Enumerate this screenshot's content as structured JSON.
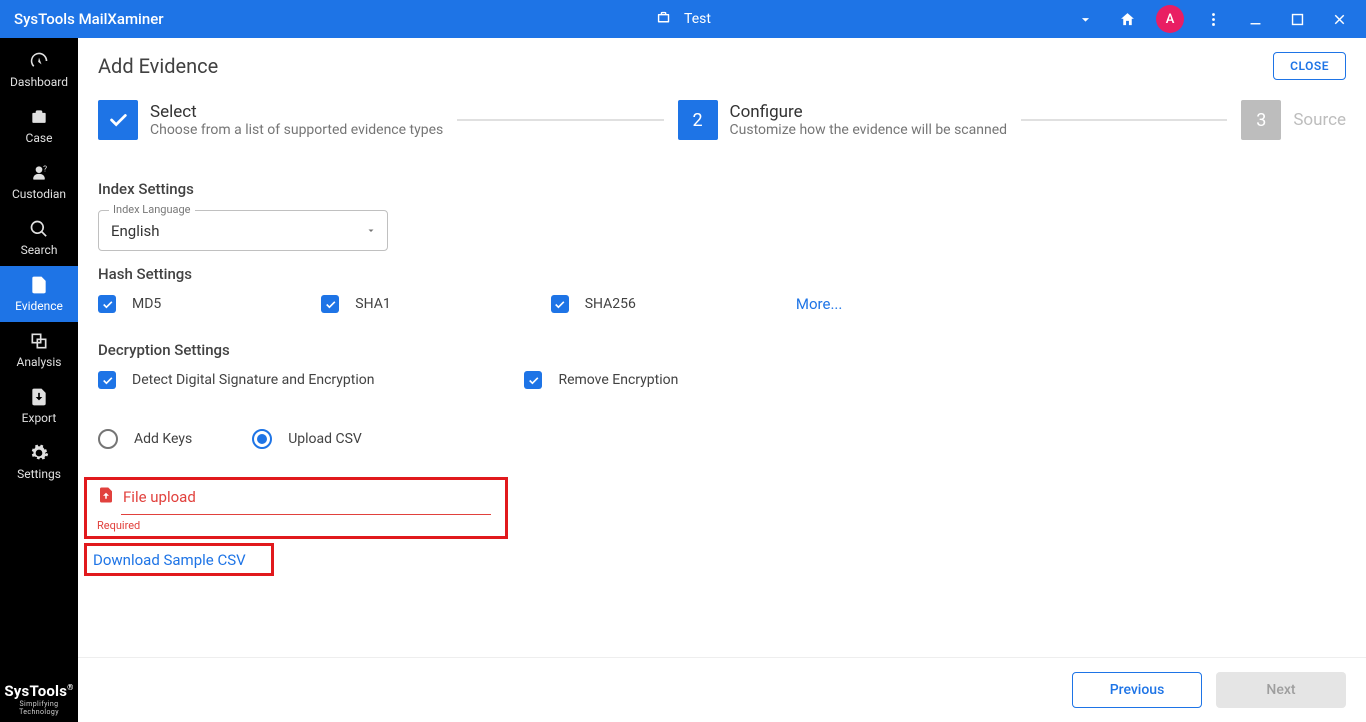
{
  "app_title": "SysTools MailXaminer",
  "case_label": "Test",
  "avatar_letter": "A",
  "sidebar": {
    "items": [
      {
        "label": "Dashboard"
      },
      {
        "label": "Case"
      },
      {
        "label": "Custodian"
      },
      {
        "label": "Search"
      },
      {
        "label": "Evidence"
      },
      {
        "label": "Analysis"
      },
      {
        "label": "Export"
      },
      {
        "label": "Settings"
      }
    ],
    "brand_top": "SysTools",
    "brand_bottom": "Simplifying Technology"
  },
  "page": {
    "title": "Add Evidence",
    "close": "CLOSE"
  },
  "stepper": {
    "step1": {
      "title": "Select",
      "desc": "Choose from a list of supported evidence types"
    },
    "step2": {
      "num": "2",
      "title": "Configure",
      "desc": "Customize how the evidence will be scanned"
    },
    "step3": {
      "num": "3",
      "title": "Source"
    }
  },
  "index": {
    "heading": "Index Settings",
    "lang_label": "Index Language",
    "lang_value": "English"
  },
  "hash": {
    "heading": "Hash Settings",
    "md5": "MD5",
    "sha1": "SHA1",
    "sha256": "SHA256",
    "more": "More..."
  },
  "decrypt": {
    "heading": "Decryption Settings",
    "detect": "Detect Digital Signature and Encryption",
    "remove": "Remove Encryption",
    "add_keys": "Add Keys",
    "upload_csv": "Upload CSV"
  },
  "file_upload": {
    "label": "File upload",
    "required": "Required"
  },
  "download_sample": "Download Sample CSV",
  "footer": {
    "previous": "Previous",
    "next": "Next"
  }
}
